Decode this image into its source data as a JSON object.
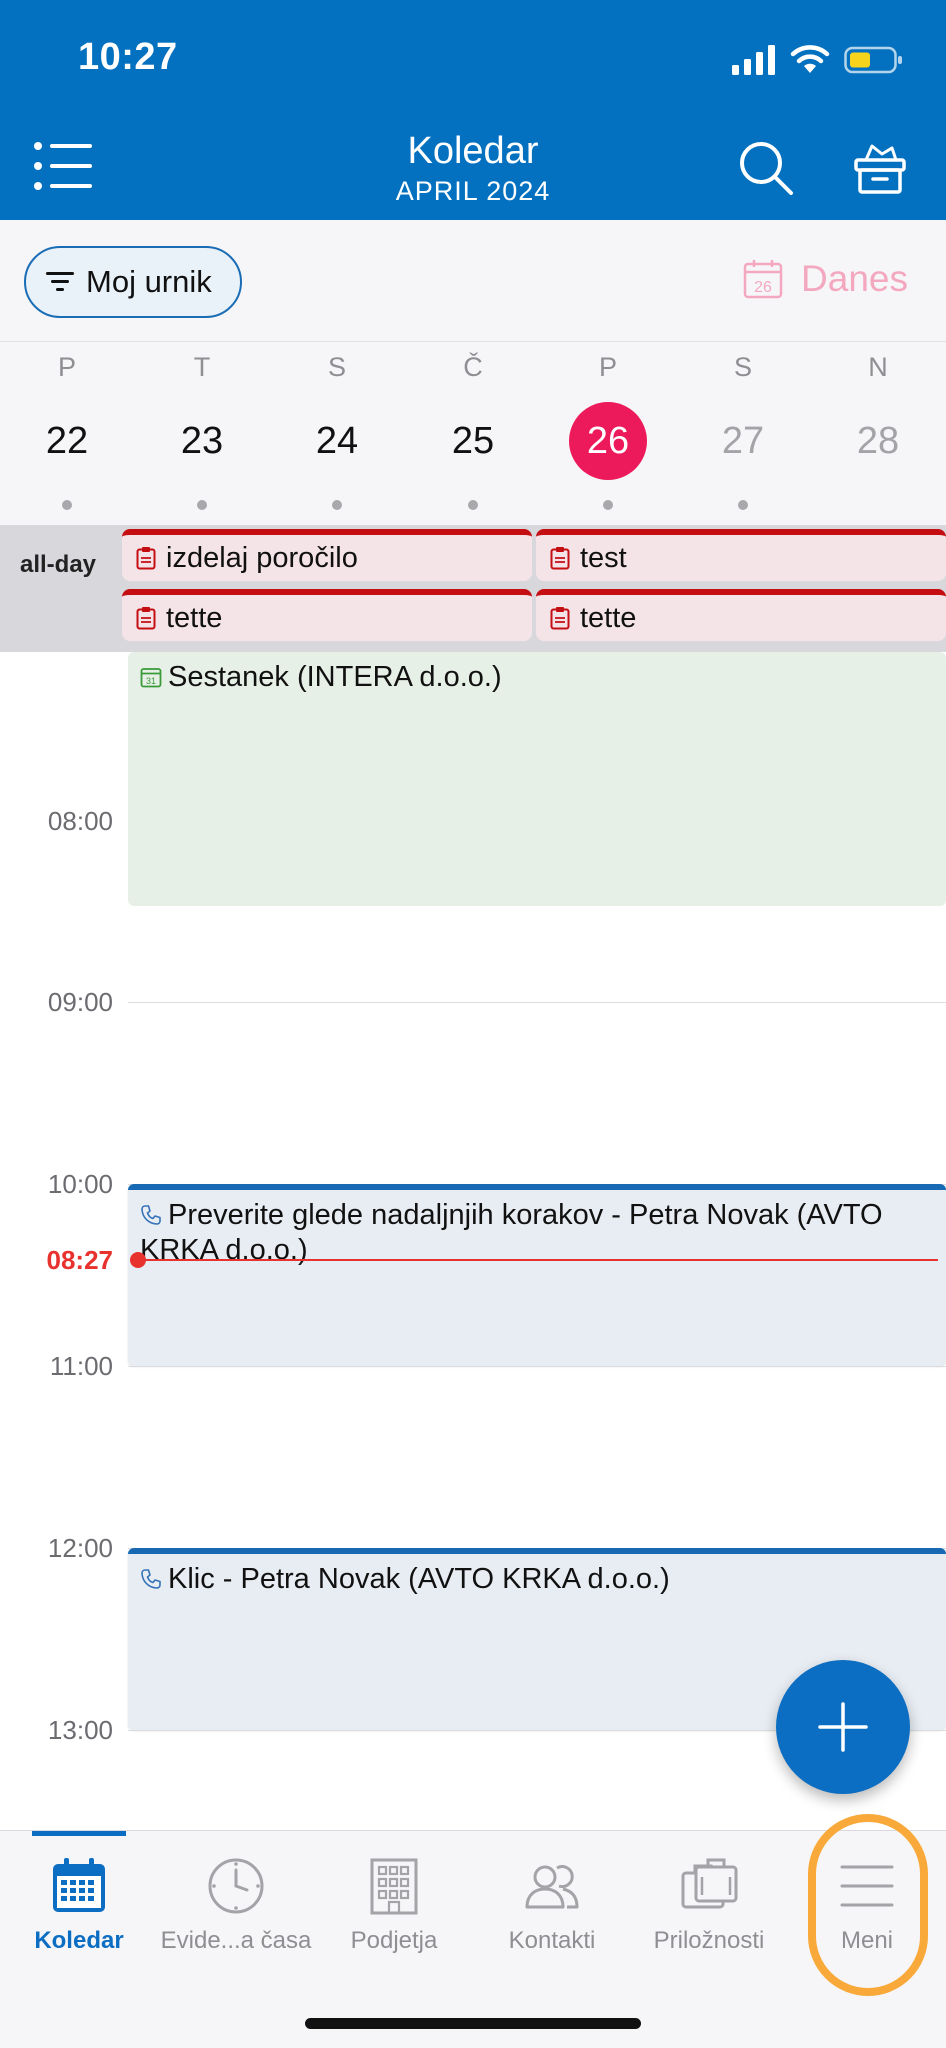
{
  "status_bar": {
    "time": "10:27"
  },
  "header": {
    "title": "Koledar",
    "subtitle": "APRIL 2024"
  },
  "toolbar": {
    "filter_label": "Moj urnik",
    "today_label": "Danes",
    "today_icon_number": "26"
  },
  "week": {
    "days": [
      {
        "letter": "P",
        "number": "22",
        "has_events": true
      },
      {
        "letter": "T",
        "number": "23",
        "has_events": true
      },
      {
        "letter": "S",
        "number": "24",
        "has_events": true
      },
      {
        "letter": "Č",
        "number": "25",
        "has_events": true
      },
      {
        "letter": "P",
        "number": "26",
        "selected": true,
        "has_events": true
      },
      {
        "letter": "S",
        "number": "27",
        "has_events": true
      },
      {
        "letter": "N",
        "number": "28",
        "has_events": false
      }
    ]
  },
  "allday": {
    "label": "all-day",
    "events": [
      {
        "title": "izdelaj poročilo"
      },
      {
        "title": "test"
      },
      {
        "title": "tette"
      },
      {
        "title": "tette"
      }
    ]
  },
  "timeline": {
    "hours": [
      "08:00",
      "09:00",
      "10:00",
      "11:00",
      "12:00",
      "13:00"
    ],
    "now_label": "08:27",
    "events": [
      {
        "type": "meeting",
        "title": "Sestanek (INTERA d.o.o.)"
      },
      {
        "type": "call",
        "title": "Preverite glede nadaljnjih korakov - Petra Novak (AVTO KRKA d.o.o.)"
      },
      {
        "type": "call",
        "title": "Klic - Petra Novak (AVTO KRKA d.o.o.)"
      }
    ]
  },
  "tabbar": {
    "tabs": [
      {
        "label": "Koledar",
        "icon": "calendar-icon",
        "active": true
      },
      {
        "label": "Evide...a časa",
        "icon": "clock-icon"
      },
      {
        "label": "Podjetja",
        "icon": "building-icon"
      },
      {
        "label": "Kontakti",
        "icon": "contacts-icon"
      },
      {
        "label": "Priložnosti",
        "icon": "briefcase-icon"
      },
      {
        "label": "Meni",
        "icon": "menu-icon"
      }
    ]
  },
  "colors": {
    "brand_blue": "#0471c0",
    "selected_day": "#ec1a5b",
    "task_red": "#c40e12",
    "meeting_green": "#e7f0e7",
    "now_red": "#e8322e",
    "highlight_orange": "#f9a93a"
  }
}
